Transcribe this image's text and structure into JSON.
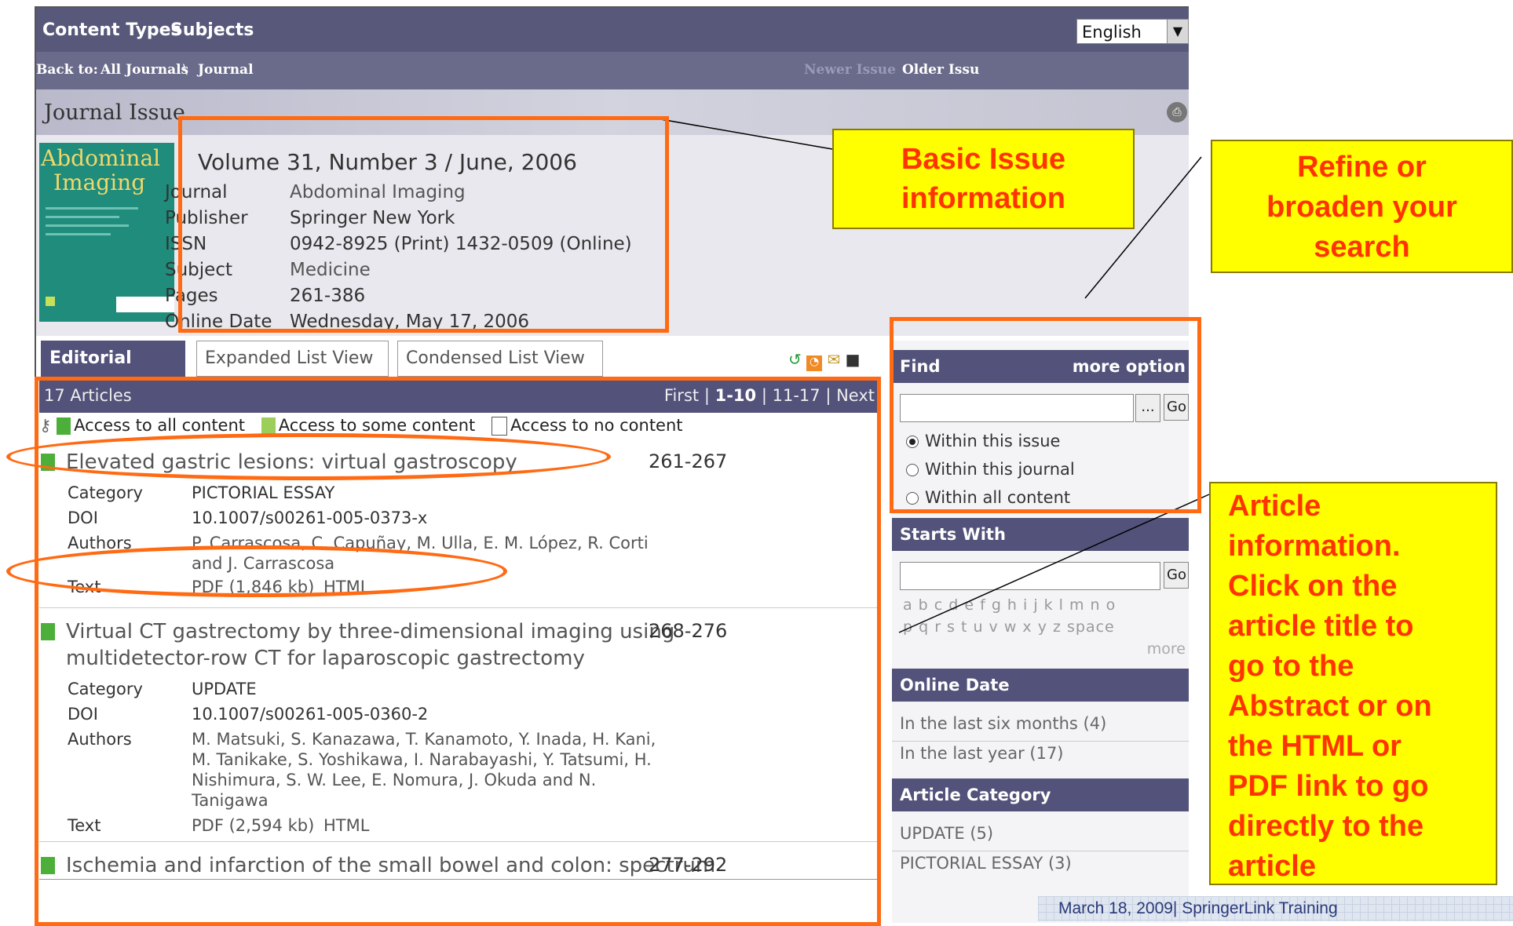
{
  "topnav": {
    "content_types": "Content Types",
    "subjects": "Subjects",
    "language": "English"
  },
  "breadcrumb": {
    "back_to": "Back to:",
    "all_journals": "All Journals",
    "sep": "\\",
    "journal": "Journal",
    "newer_issue": "Newer Issue",
    "older_issue": "Older Issu"
  },
  "page_title": "Journal Issue",
  "cover": {
    "title_line1": "Abdominal",
    "title_line2": "Imaging"
  },
  "issue": {
    "heading": "Volume 31, Number 3 / June, 2006",
    "rows": [
      {
        "label": "Journal",
        "value": "Abdominal Imaging"
      },
      {
        "label": "Publisher",
        "value": "Springer New York"
      },
      {
        "label": "ISSN",
        "value": "0942-8925 (Print) 1432-0509 (Online)"
      },
      {
        "label": "Subject",
        "value": "Medicine"
      },
      {
        "label": "Pages",
        "value": "261-386"
      },
      {
        "label": "Online Date",
        "value": "Wednesday, May 17, 2006"
      }
    ]
  },
  "tabs": {
    "editorial": "Editorial View",
    "expanded": "Expanded List View",
    "condensed": "Condensed List View"
  },
  "list": {
    "count": "17 Articles",
    "pager_first": "First",
    "pager_sep1": "|",
    "pager_current": "1-10",
    "pager_sep2": "|",
    "pager_next_range": "11-17",
    "pager_sep3": "|",
    "pager_next": "Next",
    "legend_all": "Access to all content",
    "legend_some": "Access to some content",
    "legend_none": "Access to no content"
  },
  "articles": [
    {
      "title": "Elevated gastric lesions: virtual gastroscopy",
      "pages": "261-267",
      "category_label": "Category",
      "category": "PICTORIAL ESSAY",
      "doi_label": "DOI",
      "doi": "10.1007/s00261-005-0373-x",
      "authors_label": "Authors",
      "authors_line1": "P. Carrascosa, C. Capuñay, M. Ulla, E. M. López, R. Corti",
      "authors_line2": "and J. Carrascosa",
      "text_label": "Text",
      "pdf": "PDF (1,846 kb)",
      "html": "HTML"
    },
    {
      "title_line1": "Virtual CT gastrectomy by three-dimensional imaging using",
      "title_line2": "multidetector-row CT for laparoscopic gastrectomy",
      "pages": "268-276",
      "category_label": "Category",
      "category": "UPDATE",
      "doi_label": "DOI",
      "doi": "10.1007/s00261-005-0360-2",
      "authors_label": "Authors",
      "authors_line1": "M. Matsuki, S. Kanazawa, T. Kanamoto, Y. Inada, H. Kani,",
      "authors_line2": "M. Tanikake, S. Yoshikawa, I. Narabayashi, Y. Tatsumi, H.",
      "authors_line3": "Nishimura, S. W. Lee, E. Nomura, J. Okuda and N.",
      "authors_line4": "Tanigawa",
      "text_label": "Text",
      "pdf": "PDF (2,594 kb)",
      "html": "HTML"
    },
    {
      "title": "Ischemia and infarction of the small bowel and colon: spectrum",
      "pages": "277-292"
    }
  ],
  "sidebar": {
    "find": "Find",
    "more_options": "more option",
    "go": "Go",
    "ellipsis": "...",
    "radios": [
      "Within this issue",
      "Within this journal",
      "Within all content"
    ],
    "starts_with": "Starts With",
    "letters_row1": "a b c d e f g h i j k l m n o",
    "letters_row2": "p q r s t u v w x y z space",
    "more": "more",
    "online_date": "Online Date",
    "date_items": [
      "In the last six months (4)",
      "In the last year (17)"
    ],
    "article_category": "Article Category",
    "category_items": [
      "UPDATE (5)",
      "PICTORIAL ESSAY (3)"
    ]
  },
  "callouts": {
    "basic_line1": "Basic Issue",
    "basic_line2": "information",
    "refine_line1": "Refine or",
    "refine_line2": "broaden your",
    "refine_line3": "search",
    "article": [
      "Article",
      "information.",
      "Click on the",
      "article title to",
      "go to the",
      "Abstract or on",
      "the HTML or",
      "PDF link to go",
      "directly to the",
      "article"
    ]
  },
  "footer": "March 18, 2009| SpringerLink Training"
}
